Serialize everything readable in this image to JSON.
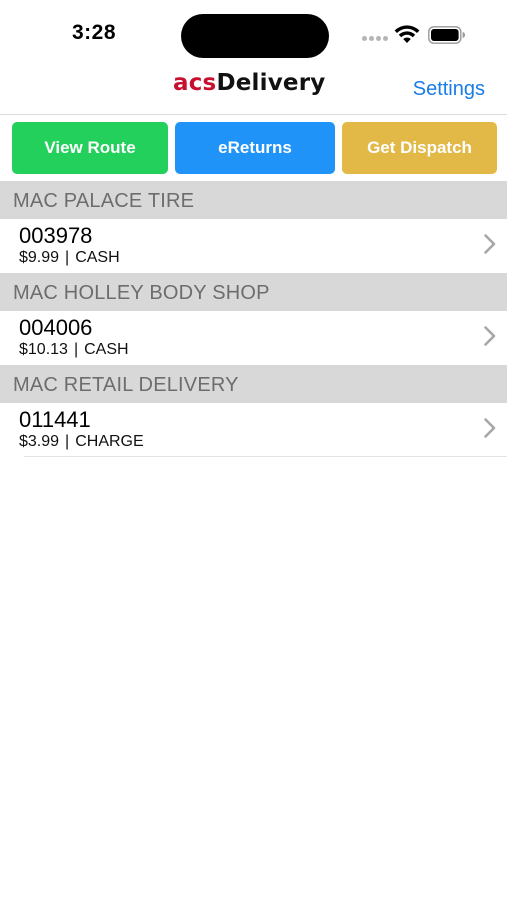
{
  "status_bar": {
    "time": "3:28",
    "icons": [
      "signal-dots-icon",
      "wifi-icon",
      "battery-icon"
    ]
  },
  "nav": {
    "logo_prefix": "acs",
    "logo_suffix": "Delivery",
    "settings_label": "Settings"
  },
  "actions": {
    "view_route": "View Route",
    "ereturns": "eReturns",
    "get_dispatch": "Get Dispatch"
  },
  "colors": {
    "view_route": "#23d05b",
    "ereturns": "#1f93f7",
    "get_dispatch": "#e2b847",
    "logo_accent": "#c8102e",
    "link": "#1a7ce6"
  },
  "deliveries": [
    {
      "customer": "MAC PALACE TIRE",
      "number": "003978",
      "amount": "$9.99",
      "payment": "CASH"
    },
    {
      "customer": "MAC HOLLEY BODY SHOP",
      "number": "004006",
      "amount": "$10.13",
      "payment": "CASH"
    },
    {
      "customer": "MAC RETAIL DELIVERY",
      "number": "011441",
      "amount": "$3.99",
      "payment": "CHARGE"
    }
  ]
}
